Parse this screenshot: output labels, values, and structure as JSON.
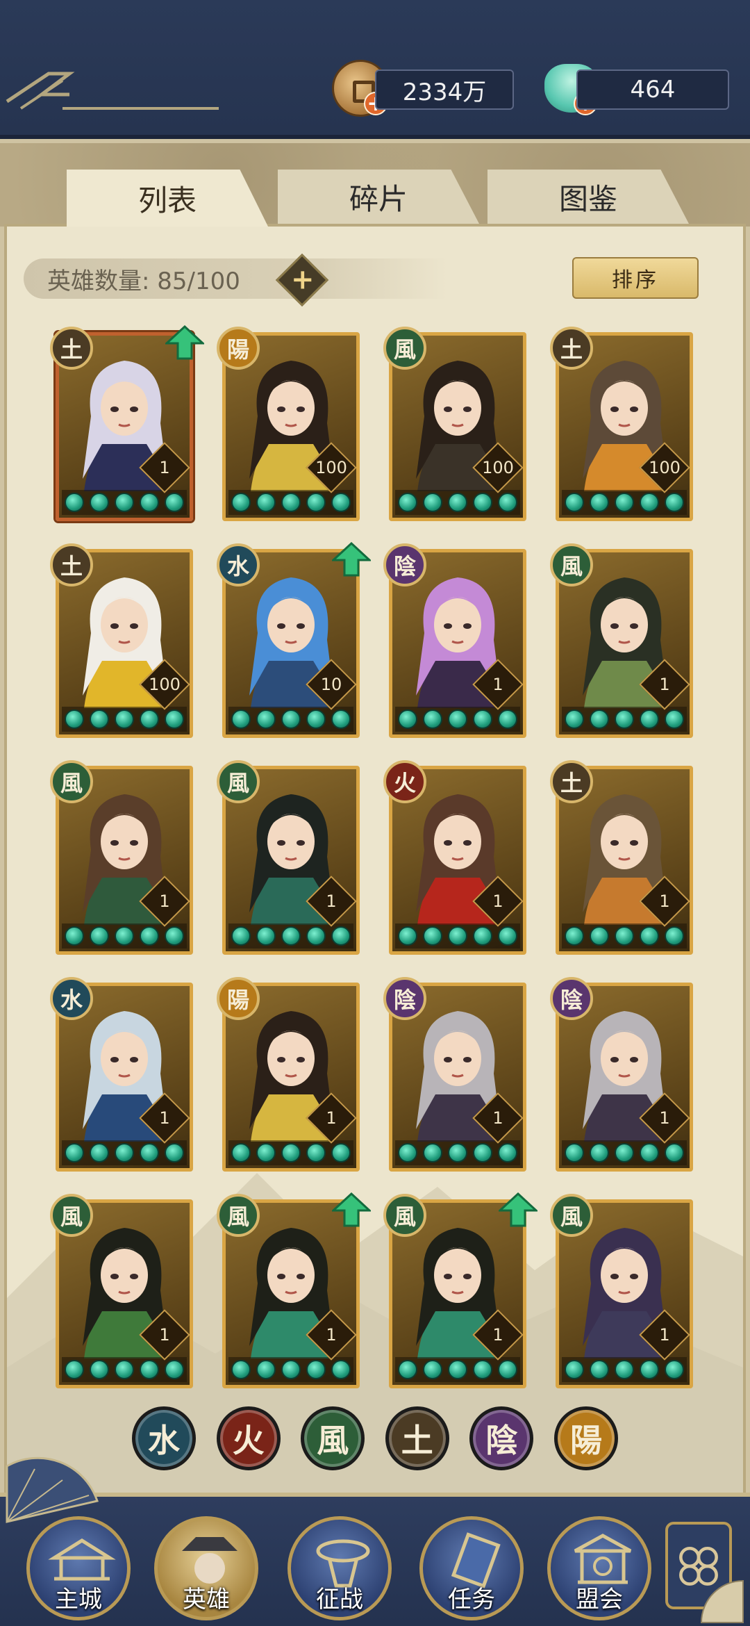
{
  "resources": {
    "coins": "2334万",
    "jade": "464"
  },
  "tabs": [
    {
      "label": "列表",
      "active": true
    },
    {
      "label": "碎片",
      "active": false
    },
    {
      "label": "图鉴",
      "active": false
    }
  ],
  "hero_count": {
    "label": "英雄数量: 85/100"
  },
  "sort_label": "排序",
  "heroes": [
    {
      "element": "土",
      "element_key": "earth",
      "level": "1",
      "upgrade": true,
      "frame": "red",
      "hair": "#d8d4e6",
      "outfit": "#2c2f58"
    },
    {
      "element": "陽",
      "element_key": "yang",
      "level": "100",
      "upgrade": false,
      "frame": "gold",
      "hair": "#2b2018",
      "outfit": "#d6b640"
    },
    {
      "element": "風",
      "element_key": "wind",
      "level": "100",
      "upgrade": false,
      "frame": "gold",
      "hair": "#2a2018",
      "outfit": "#3a3228"
    },
    {
      "element": "土",
      "element_key": "earth",
      "level": "100",
      "upgrade": false,
      "frame": "gold",
      "hair": "#5d4a38",
      "outfit": "#d58a2c"
    },
    {
      "element": "土",
      "element_key": "earth",
      "level": "100",
      "upgrade": false,
      "frame": "gold",
      "hair": "#f0ede6",
      "outfit": "#e1b62a"
    },
    {
      "element": "水",
      "element_key": "water",
      "level": "10",
      "upgrade": true,
      "frame": "gold",
      "hair": "#4a8ed6",
      "outfit": "#2c4d7a"
    },
    {
      "element": "陰",
      "element_key": "yin",
      "level": "1",
      "upgrade": false,
      "frame": "gold",
      "hair": "#c48ad6",
      "outfit": "#3a2a4a"
    },
    {
      "element": "風",
      "element_key": "wind",
      "level": "1",
      "upgrade": false,
      "frame": "gold",
      "hair": "#2a3024",
      "outfit": "#6f8a4a"
    },
    {
      "element": "風",
      "element_key": "wind",
      "level": "1",
      "upgrade": false,
      "frame": "gold",
      "hair": "#5a3e2a",
      "outfit": "#2f5a3c"
    },
    {
      "element": "風",
      "element_key": "wind",
      "level": "1",
      "upgrade": false,
      "frame": "gold",
      "hair": "#1e2420",
      "outfit": "#2a6a58"
    },
    {
      "element": "火",
      "element_key": "fire",
      "level": "1",
      "upgrade": false,
      "frame": "gold",
      "hair": "#5a3a2a",
      "outfit": "#b6261c"
    },
    {
      "element": "土",
      "element_key": "earth",
      "level": "1",
      "upgrade": false,
      "frame": "gold",
      "hair": "#6a5438",
      "outfit": "#c67a2e"
    },
    {
      "element": "水",
      "element_key": "water",
      "level": "1",
      "upgrade": false,
      "frame": "gold",
      "hair": "#c8d6e0",
      "outfit": "#284a7a"
    },
    {
      "element": "陽",
      "element_key": "yang",
      "level": "1",
      "upgrade": false,
      "frame": "gold",
      "hair": "#2b2018",
      "outfit": "#d6b640"
    },
    {
      "element": "陰",
      "element_key": "yin",
      "level": "1",
      "upgrade": false,
      "frame": "gold",
      "hair": "#b8b4b8",
      "outfit": "#3e3448"
    },
    {
      "element": "陰",
      "element_key": "yin",
      "level": "1",
      "upgrade": false,
      "frame": "gold",
      "hair": "#b8b4b8",
      "outfit": "#3e3448"
    },
    {
      "element": "風",
      "element_key": "wind",
      "level": "1",
      "upgrade": false,
      "frame": "gold",
      "hair": "#1e2018",
      "outfit": "#3f7a3a"
    },
    {
      "element": "風",
      "element_key": "wind",
      "level": "1",
      "upgrade": true,
      "frame": "gold",
      "hair": "#1e2018",
      "outfit": "#2e8a6a"
    },
    {
      "element": "風",
      "element_key": "wind",
      "level": "1",
      "upgrade": true,
      "frame": "gold",
      "hair": "#1e2018",
      "outfit": "#2e8a6a"
    },
    {
      "element": "風",
      "element_key": "wind",
      "level": "1",
      "upgrade": false,
      "frame": "gold",
      "hair": "#3a3050",
      "outfit": "#3e3a5a"
    }
  ],
  "element_filters": [
    {
      "label": "水",
      "key": "water",
      "color": "#214a5a"
    },
    {
      "label": "火",
      "key": "fire",
      "color": "#7a2418"
    },
    {
      "label": "風",
      "key": "wind",
      "color": "#2d5e38"
    },
    {
      "label": "土",
      "key": "earth",
      "color": "#4b3b24"
    },
    {
      "label": "陰",
      "key": "yin",
      "color": "#5a356e"
    },
    {
      "label": "陽",
      "key": "yang",
      "color": "#b67a1a"
    }
  ],
  "nav": [
    {
      "label": "主城",
      "key": "city",
      "active": false
    },
    {
      "label": "英雄",
      "key": "heroes",
      "active": true
    },
    {
      "label": "征战",
      "key": "battle",
      "active": false
    },
    {
      "label": "任务",
      "key": "tasks",
      "active": false
    },
    {
      "label": "盟会",
      "key": "guild",
      "active": false
    }
  ]
}
